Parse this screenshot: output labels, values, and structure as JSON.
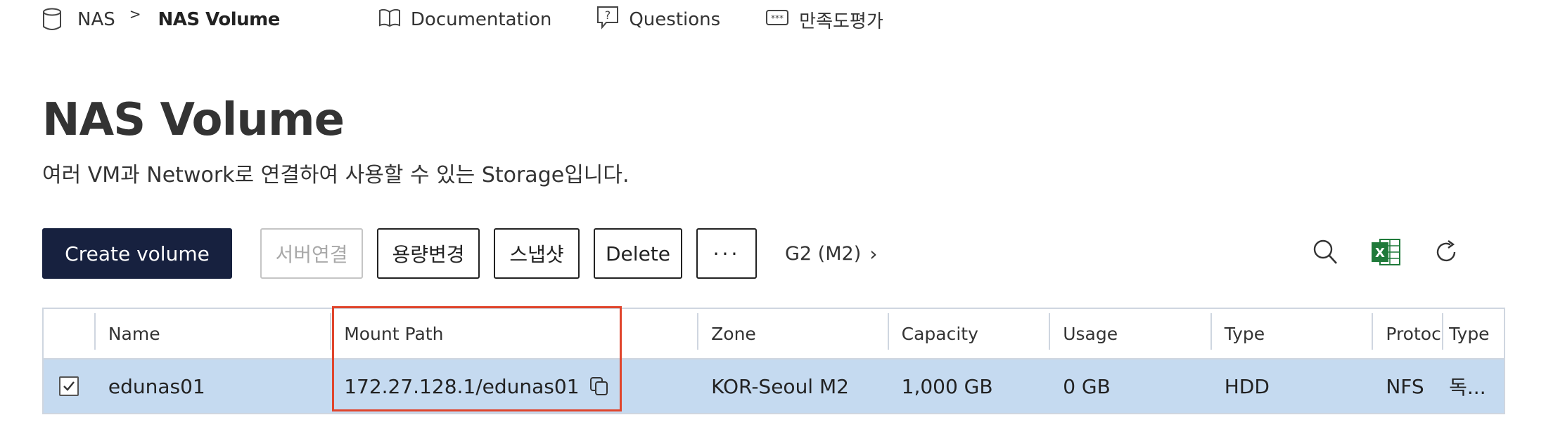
{
  "breadcrumb": {
    "root": "NAS",
    "separator": ">",
    "current": "NAS Volume"
  },
  "top_links": [
    {
      "label": "Documentation",
      "icon": "book-icon"
    },
    {
      "label": "Questions",
      "icon": "question-bubble-icon"
    },
    {
      "label": "만족도평가",
      "icon": "rating-icon"
    }
  ],
  "page": {
    "title": "NAS Volume",
    "description": "여러 VM과 Network로 연결하여 사용할 수 있는 Storage입니다."
  },
  "toolbar": {
    "create_label": "Create volume",
    "connect_label": "서버연결",
    "resize_label": "용량변경",
    "snapshot_label": "스냅샷",
    "delete_label": "Delete",
    "more_label": "···",
    "region_label": "G2 (M2)",
    "region_chevron": "›",
    "icons": [
      "search-icon",
      "excel-icon",
      "refresh-icon"
    ]
  },
  "table": {
    "headers": {
      "name": "Name",
      "mount_path": "Mount Path",
      "zone": "Zone",
      "capacity": "Capacity",
      "usage": "Usage",
      "type": "Type",
      "protocol": "Protocol",
      "type2": "Type"
    },
    "rows": [
      {
        "selected": true,
        "name": "edunas01",
        "mount_path": "172.27.128.1/edunas01",
        "zone": "KOR-Seoul M2",
        "capacity": "1,000 GB",
        "usage": "0 GB",
        "type": "HDD",
        "protocol": "NFS",
        "type2": "독..."
      }
    ]
  },
  "colors": {
    "primary_button": "#17213f",
    "selected_row": "#c5daf0",
    "highlight_border": "#e0452c",
    "excel_green": "#1f7a3a"
  }
}
